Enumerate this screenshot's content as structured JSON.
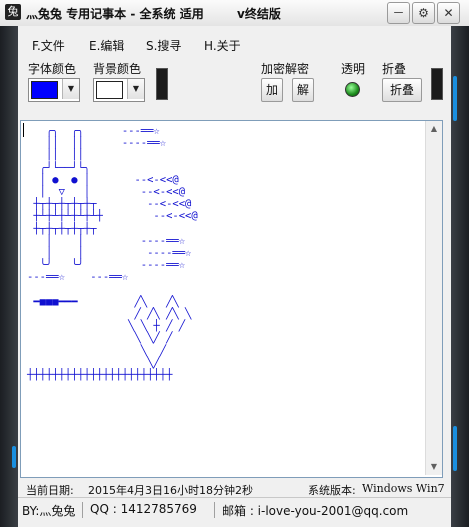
{
  "window": {
    "title": "灬兔兔 专用记事本 - 全系统 适用",
    "title_suffix": "v终结版",
    "app_icon_glyph": "兔",
    "controls": {
      "minimize": "－",
      "settings": "⚙",
      "close": "✕"
    }
  },
  "menu": {
    "items": [
      "F.文件",
      "E.编辑",
      "S.搜寻",
      "H.关于"
    ]
  },
  "toolbar": {
    "font_color_label": "字体颜色",
    "font_color_value": "#0000ff",
    "bg_color_label": "背景颜色",
    "bg_color_value": "#ffffff",
    "crypto_label": "加密解密",
    "encrypt_label": "加",
    "decrypt_label": "解",
    "transparency_label": "透明",
    "fold_label": "折叠",
    "fold_button_label": "折叠",
    "dropdown_arrow": "▼"
  },
  "editor": {
    "text_color": "#1010d0",
    "ascii_art": "   ╭╮  ╭╮      ---══☆\n   ││  ││      ----══☆\n   ││  ││\n  ╭┘└──┘└╮\n  │ ●  ● │       --<-<<@\n  │  ▽   │        --<-<<@\n ┼┬┼┬┼┬┼┬┼┬        --<-<<@\n ┼┴┼┴┼┴┼┴┼┴┼        --<-<<@\n ┼┬┼┬┼┬┼┬┼┬\n   │    │         ----══☆\n   │    │          ----══☆\n  ╰╯   ╰╯         ----══☆\n---══☆    ---══☆\n\n ━■■■━━━         ╱╲   ╱╲\n                 ╱ ╱╲ ╱╲ ╲\n                ╲ ╲ ┼ ╱ ╱\n                 ╲ ╲╱ ╱\n                  ╲  ╱\n                   ╲╱\n┼┼┼┼┼┼┼┼┼┼┼┼┼┼┼┼┼┼┼┼┼┼┼"
  },
  "status": {
    "date_label": "当前日期:",
    "date_value": "2015年4月3日16小时18分钟2秒",
    "os_label": "系统版本:",
    "os_value": "Windows Win7"
  },
  "footer": {
    "author": "BY:灬兔兔",
    "qq": "QQ : 1412785769",
    "email": "邮箱 : i-love-you-2001@qq.com"
  }
}
